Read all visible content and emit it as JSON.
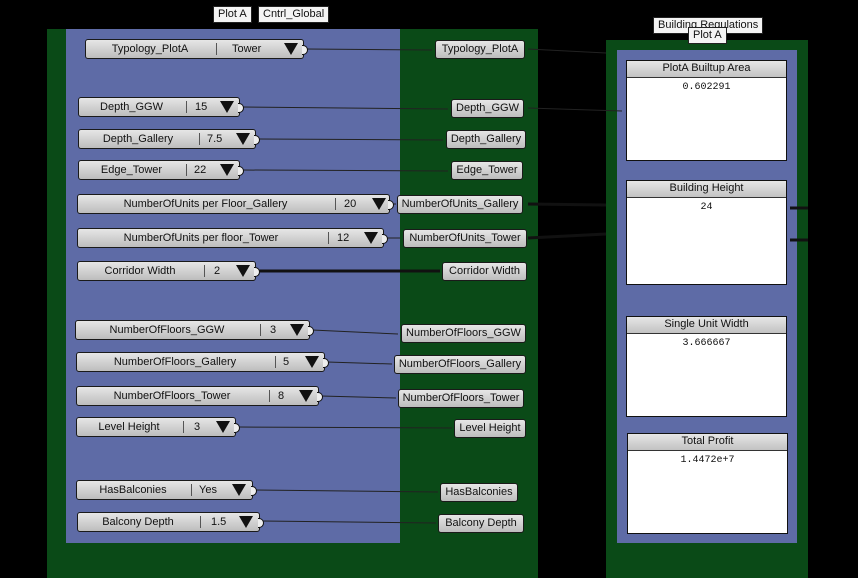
{
  "labels": {
    "plot_a": "Plot A",
    "cntrl_global": "Cntrl_Global",
    "building_regulations": "Building Regulations",
    "plot_a_2": "Plot A"
  },
  "value_lists": [
    {
      "name": "Typology_PlotA",
      "value": "Tower"
    },
    {
      "name": "Depth_GGW",
      "value": "15"
    },
    {
      "name": "Depth_Gallery",
      "value": "7.5"
    },
    {
      "name": "Edge_Tower",
      "value": "22"
    },
    {
      "name": "NumberOfUnits per Floor_Gallery",
      "value": "20"
    },
    {
      "name": "NumberOfUnits per floor_Tower",
      "value": "12"
    },
    {
      "name": "Corridor Width",
      "value": "2"
    },
    {
      "name": "NumberOfFloors_GGW",
      "value": "3"
    },
    {
      "name": "NumberOfFloors_Gallery",
      "value": "5"
    },
    {
      "name": "NumberOfFloors_Tower",
      "value": "8"
    },
    {
      "name": "Level Height",
      "value": "3"
    },
    {
      "name": "HasBalconies",
      "value": "Yes"
    },
    {
      "name": "Balcony Depth",
      "value": "1.5"
    }
  ],
  "relays": [
    "Typology_PlotA",
    "Depth_GGW",
    "Depth_Gallery",
    "Edge_Tower",
    "NumberOfUnits_Gallery",
    "NumberOfUnits_Tower",
    "Corridor Width",
    "NumberOfFloors_GGW",
    "NumberOfFloors_Gallery",
    "NumberOfFloors_Tower",
    "Level Height",
    "HasBalconies",
    "Balcony Depth"
  ],
  "panels": [
    {
      "title": "PlotA Builtup Area",
      "value": "0.602291"
    },
    {
      "title": "Building Height",
      "value": "24"
    },
    {
      "title": "Single Unit Width",
      "value": "3.666667"
    },
    {
      "title": "Total Profit",
      "value": "1.4472e+7"
    }
  ],
  "colors": {
    "canvas": "#000000",
    "group_green": "#0a4a17",
    "group_blue": "#5e6ba6"
  }
}
